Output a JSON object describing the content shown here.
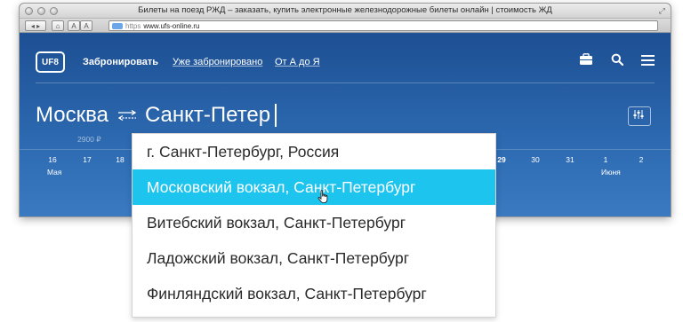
{
  "window": {
    "title": "Билеты на поезд РЖД – заказать, купить электронные железнодорожные билеты онлайн | стоимость ЖД",
    "url_scheme": "https",
    "url": "www.ufs-online.ru",
    "text_size_buttons": [
      "A",
      "A"
    ]
  },
  "header": {
    "logo_text": "UF8",
    "nav": {
      "book": "Забронировать",
      "booked": "Уже забронировано",
      "atoz": "От А до Я"
    },
    "icons": [
      "briefcase-icon",
      "search-icon",
      "menu-icon"
    ]
  },
  "search": {
    "from": "Москва",
    "to_input": "Санкт-Петер",
    "price": "2900 ₽"
  },
  "dates": {
    "left": [
      "16",
      "17",
      "18"
    ],
    "right": [
      "29",
      "30",
      "31",
      "1",
      "2"
    ],
    "month_left": "Мая",
    "month_right": "Июня"
  },
  "suggestions": [
    "г. Санкт-Петербург, Россия",
    "Московский вокзал, Санкт-Петербург",
    "Витебский вокзал, Санкт-Петербург",
    "Ладожский вокзал, Санкт-Петербург",
    "Финляндский вокзал, Санкт-Петербург"
  ],
  "active_suggestion": 1,
  "colors": {
    "header_blue": "#1f5a9c",
    "highlight": "#1cc4ee"
  }
}
